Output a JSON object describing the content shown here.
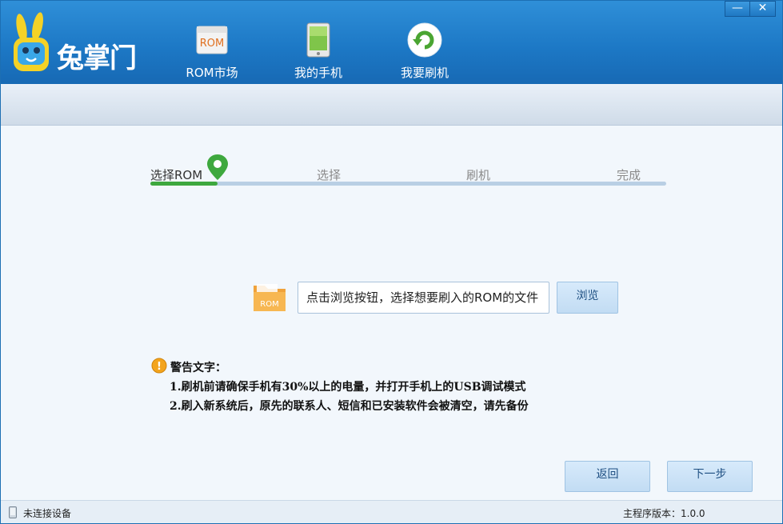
{
  "app": {
    "name": "兔掌门"
  },
  "window_controls": {
    "minimize": "—",
    "close": "✕"
  },
  "nav": {
    "rom_market": "ROM市场",
    "rom_icon_text": "ROM",
    "my_phone": "我的手机",
    "flash": "我要刷机"
  },
  "steps": [
    {
      "label": "选择ROM",
      "active": true
    },
    {
      "label": "选择",
      "active": false
    },
    {
      "label": "刷机",
      "active": false
    },
    {
      "label": "完成",
      "active": false
    }
  ],
  "step_progress_fraction": 0.13,
  "file_chooser": {
    "folder_icon_text": "ROM",
    "placeholder": "点击浏览按钮，选择想要刷入的ROM的文件",
    "browse_label": "浏览"
  },
  "warning": {
    "icon_text": "!",
    "title": "警告文字：",
    "line1": "1.刷机前请确保手机有30%以上的电量，并打开手机上的USB调试模式",
    "line2": "2.刷入新系统后，原先的联系人、短信和已安装软件会被清空，请先备份"
  },
  "actions": {
    "back": "返回",
    "next": "下一步"
  },
  "status": {
    "device": "未连接设备",
    "version": "主程序版本：1.0.0"
  },
  "colors": {
    "header_blue": "#1d79c6",
    "progress_green": "#3ea83e",
    "track_blue": "#b9cfe4",
    "button_bg": "#c9e1f6"
  }
}
